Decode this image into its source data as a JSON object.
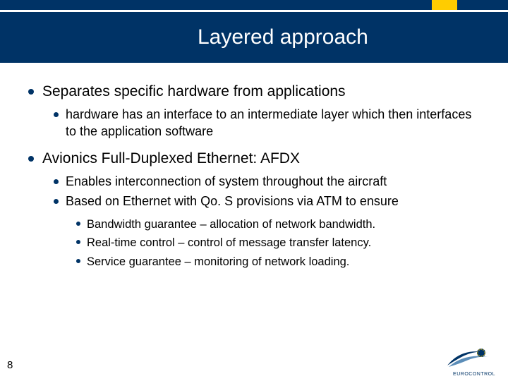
{
  "header": {
    "title": "Layered approach"
  },
  "bullets": [
    {
      "text": "Separates specific hardware from applications",
      "children": [
        {
          "text": "hardware has an interface to an intermediate layer which then interfaces to the application software"
        }
      ]
    },
    {
      "text": "Avionics Full-Duplexed Ethernet: AFDX",
      "children": [
        {
          "text": "Enables interconnection of system throughout the aircraft"
        },
        {
          "text": "Based on Ethernet with Qo. S provisions via ATM to ensure",
          "children": [
            {
              "text": "Bandwidth guarantee – allocation of network bandwidth."
            },
            {
              "text": "Real-time control – control of message transfer latency."
            },
            {
              "text": "Service guarantee – monitoring of network loading."
            }
          ]
        }
      ]
    }
  ],
  "footer": {
    "page_number": "8",
    "logo_label": "EUROCONTROL"
  }
}
